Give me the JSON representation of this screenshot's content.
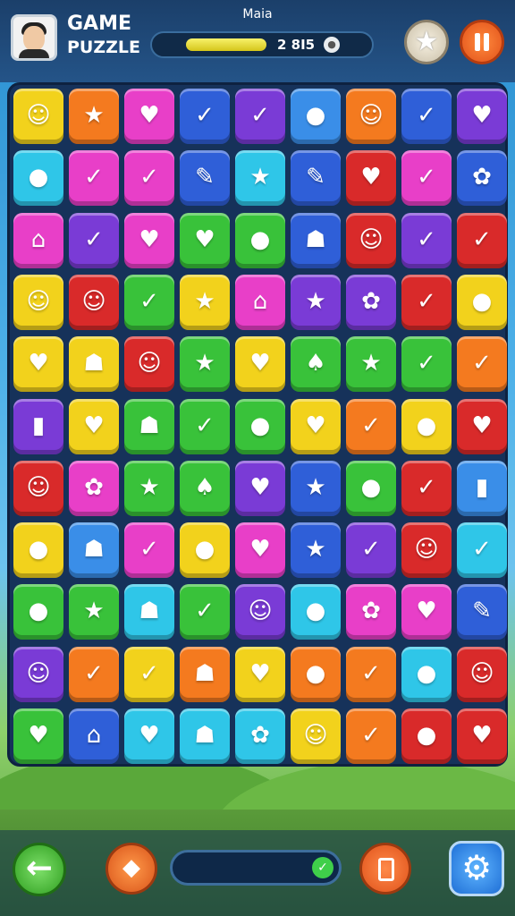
{
  "header": {
    "title_line1": "GAME",
    "title_line2": "PUZZLE",
    "level_name": "Maia",
    "score": "2 8I5",
    "score_progress": 0.45
  },
  "colors": {
    "yellow": "#f2d21c",
    "orange": "#f47a1f",
    "magenta": "#e83fc8",
    "blue": "#2f5fd8",
    "purple": "#7a3bd6",
    "green": "#39c23a",
    "red": "#d92a2a",
    "cyan": "#2fc6e8",
    "sky": "#3a8ee8"
  },
  "board": {
    "rows": [
      [
        [
          "yellow",
          "face-icon"
        ],
        [
          "orange",
          "star-icon"
        ],
        [
          "magenta",
          "heart-icon"
        ],
        [
          "blue",
          "check-icon"
        ],
        [
          "purple",
          "check-icon"
        ],
        [
          "sky",
          "drop-icon"
        ],
        [
          "orange",
          "face-icon"
        ],
        [
          "blue",
          "check-icon"
        ],
        [
          "purple",
          "heart-icon"
        ]
      ],
      [
        [
          "cyan",
          "drop-icon"
        ],
        [
          "magenta",
          "check-icon"
        ],
        [
          "magenta",
          "check-icon"
        ],
        [
          "blue",
          "pencil-icon"
        ],
        [
          "cyan",
          "star-icon"
        ],
        [
          "blue",
          "pencil-icon"
        ],
        [
          "red",
          "heart-icon"
        ],
        [
          "magenta",
          "check-icon"
        ],
        [
          "blue",
          "flower-icon"
        ]
      ],
      [
        [
          "magenta",
          "house-icon"
        ],
        [
          "purple",
          "check-icon"
        ],
        [
          "magenta",
          "heart-icon"
        ],
        [
          "green",
          "heart-icon"
        ],
        [
          "green",
          "drop-icon"
        ],
        [
          "blue",
          "ghost-icon"
        ],
        [
          "red",
          "face-icon"
        ],
        [
          "purple",
          "check-icon"
        ],
        [
          "red",
          "check-icon"
        ]
      ],
      [
        [
          "yellow",
          "face-icon"
        ],
        [
          "red",
          "face-icon"
        ],
        [
          "green",
          "check-icon"
        ],
        [
          "yellow",
          "star-icon"
        ],
        [
          "magenta",
          "house-icon"
        ],
        [
          "purple",
          "star-icon"
        ],
        [
          "purple",
          "flower-icon"
        ],
        [
          "red",
          "check-icon"
        ],
        [
          "yellow",
          "drop-icon"
        ]
      ],
      [
        [
          "yellow",
          "heart-icon"
        ],
        [
          "yellow",
          "ghost-icon"
        ],
        [
          "red",
          "face-icon"
        ],
        [
          "green",
          "star-icon"
        ],
        [
          "yellow",
          "heart-icon"
        ],
        [
          "green",
          "mushroom-icon"
        ],
        [
          "green",
          "star-icon"
        ],
        [
          "green",
          "check-icon"
        ],
        [
          "orange",
          "check-icon"
        ]
      ],
      [
        [
          "purple",
          "bottle-icon"
        ],
        [
          "yellow",
          "heart-icon"
        ],
        [
          "green",
          "ghost-icon"
        ],
        [
          "green",
          "check-icon"
        ],
        [
          "green",
          "drop-icon"
        ],
        [
          "yellow",
          "heart-icon"
        ],
        [
          "orange",
          "check-icon"
        ],
        [
          "yellow",
          "drop-icon"
        ],
        [
          "red",
          "heart-icon"
        ]
      ],
      [
        [
          "red",
          "face-icon"
        ],
        [
          "magenta",
          "flower-icon"
        ],
        [
          "green",
          "star-icon"
        ],
        [
          "green",
          "mushroom-icon"
        ],
        [
          "purple",
          "heart-icon"
        ],
        [
          "blue",
          "star-icon"
        ],
        [
          "green",
          "drop-icon"
        ],
        [
          "red",
          "check-icon"
        ],
        [
          "sky",
          "bottle-icon"
        ]
      ],
      [
        [
          "yellow",
          "drop-icon"
        ],
        [
          "sky",
          "ghost-icon"
        ],
        [
          "magenta",
          "check-icon"
        ],
        [
          "yellow",
          "drop-icon"
        ],
        [
          "magenta",
          "heart-icon"
        ],
        [
          "blue",
          "star-icon"
        ],
        [
          "purple",
          "check-icon"
        ],
        [
          "red",
          "face-icon"
        ],
        [
          "cyan",
          "check-icon"
        ]
      ],
      [
        [
          "green",
          "drop-icon"
        ],
        [
          "green",
          "star-icon"
        ],
        [
          "cyan",
          "ghost-icon"
        ],
        [
          "green",
          "check-icon"
        ],
        [
          "purple",
          "face-icon"
        ],
        [
          "cyan",
          "drop-icon"
        ],
        [
          "magenta",
          "flower-icon"
        ],
        [
          "magenta",
          "heart-icon"
        ],
        [
          "blue",
          "pencil-icon"
        ]
      ],
      [
        [
          "purple",
          "face-icon"
        ],
        [
          "orange",
          "check-icon"
        ],
        [
          "yellow",
          "check-icon"
        ],
        [
          "orange",
          "ghost-icon"
        ],
        [
          "yellow",
          "heart-icon"
        ],
        [
          "orange",
          "drop-icon"
        ],
        [
          "orange",
          "check-icon"
        ],
        [
          "cyan",
          "drop-icon"
        ],
        [
          "red",
          "face-icon"
        ]
      ],
      [
        [
          "green",
          "heart-icon"
        ],
        [
          "blue",
          "house-icon"
        ],
        [
          "cyan",
          "heart-icon"
        ],
        [
          "cyan",
          "ghost-icon"
        ],
        [
          "cyan",
          "flower-icon"
        ],
        [
          "yellow",
          "face-icon"
        ],
        [
          "orange",
          "check-icon"
        ],
        [
          "red",
          "drop-icon"
        ],
        [
          "red",
          "heart-icon"
        ]
      ]
    ]
  },
  "footer": {
    "level_progress": 0.0
  }
}
